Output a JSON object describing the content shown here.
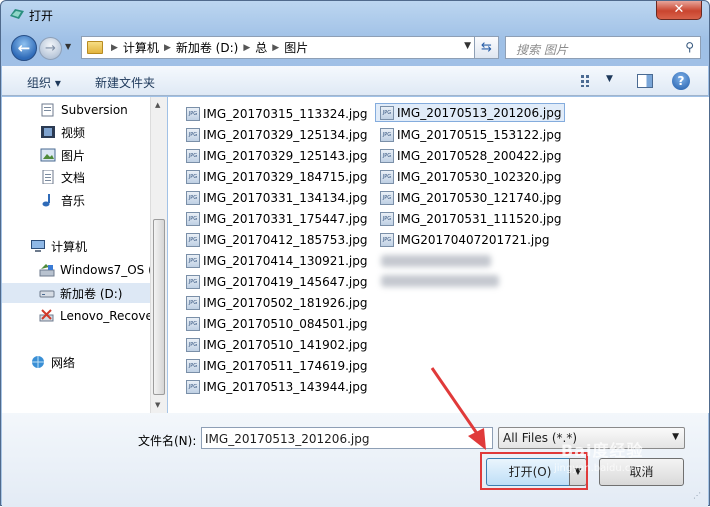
{
  "window": {
    "title": "打开",
    "close_label": "✕"
  },
  "nav": {
    "breadcrumbs": [
      "计算机",
      "新加卷 (D:)",
      "总",
      "图片"
    ],
    "search_placeholder": "搜索 图片"
  },
  "toolbar": {
    "organize_label": "组织 ▾",
    "new_folder_label": "新建文件夹",
    "help_label": "?"
  },
  "sidebar": {
    "items": [
      {
        "label": "Subversion",
        "icon": "subversion-icon"
      },
      {
        "label": "视频",
        "icon": "video-library-icon"
      },
      {
        "label": "图片",
        "icon": "pictures-library-icon"
      },
      {
        "label": "文档",
        "icon": "documents-library-icon"
      },
      {
        "label": "音乐",
        "icon": "music-library-icon"
      },
      {
        "label": "计算机",
        "icon": "computer-icon"
      },
      {
        "label": "Windows7_OS (",
        "icon": "drive-c-icon"
      },
      {
        "label": "新加卷 (D:)",
        "icon": "drive-d-icon"
      },
      {
        "label": "Lenovo_Recove",
        "icon": "recovery-drive-icon"
      },
      {
        "label": "网络",
        "icon": "network-icon"
      }
    ],
    "selected_index": 7
  },
  "files": {
    "column1": [
      "IMG_20170315_113324.jpg",
      "IMG_20170329_125134.jpg",
      "IMG_20170329_125143.jpg",
      "IMG_20170329_184715.jpg",
      "IMG_20170331_134134.jpg",
      "IMG_20170331_175447.jpg",
      "IMG_20170412_185753.jpg",
      "IMG_20170414_130921.jpg",
      "IMG_20170419_145647.jpg",
      "IMG_20170502_181926.jpg",
      "IMG_20170510_084501.jpg",
      "IMG_20170510_141902.jpg",
      "IMG_20170511_174619.jpg",
      "IMG_20170513_143944.jpg"
    ],
    "column2": [
      "IMG_20170513_201206.jpg",
      "IMG_20170515_153122.jpg",
      "IMG_20170528_200422.jpg",
      "IMG_20170530_102320.jpg",
      "IMG_20170530_121740.jpg",
      "IMG_20170531_111520.jpg",
      "IMG20170407201721.jpg"
    ],
    "selected": "IMG_20170513_201206.jpg",
    "file_icon_text": "JPG"
  },
  "bottom": {
    "filename_label": "文件名(N):",
    "filename_value": "IMG_20170513_201206.jpg",
    "filter_value": "All Files (*.*)",
    "open_label": "打开(O)",
    "cancel_label": "取消"
  },
  "watermark": {
    "line1": "Bai度经验",
    "line2": "jingyan.baidu.com"
  },
  "colors": {
    "highlight": "#e03a3a",
    "selection": "#e1ecf9",
    "accent": "#2f6bb8"
  }
}
